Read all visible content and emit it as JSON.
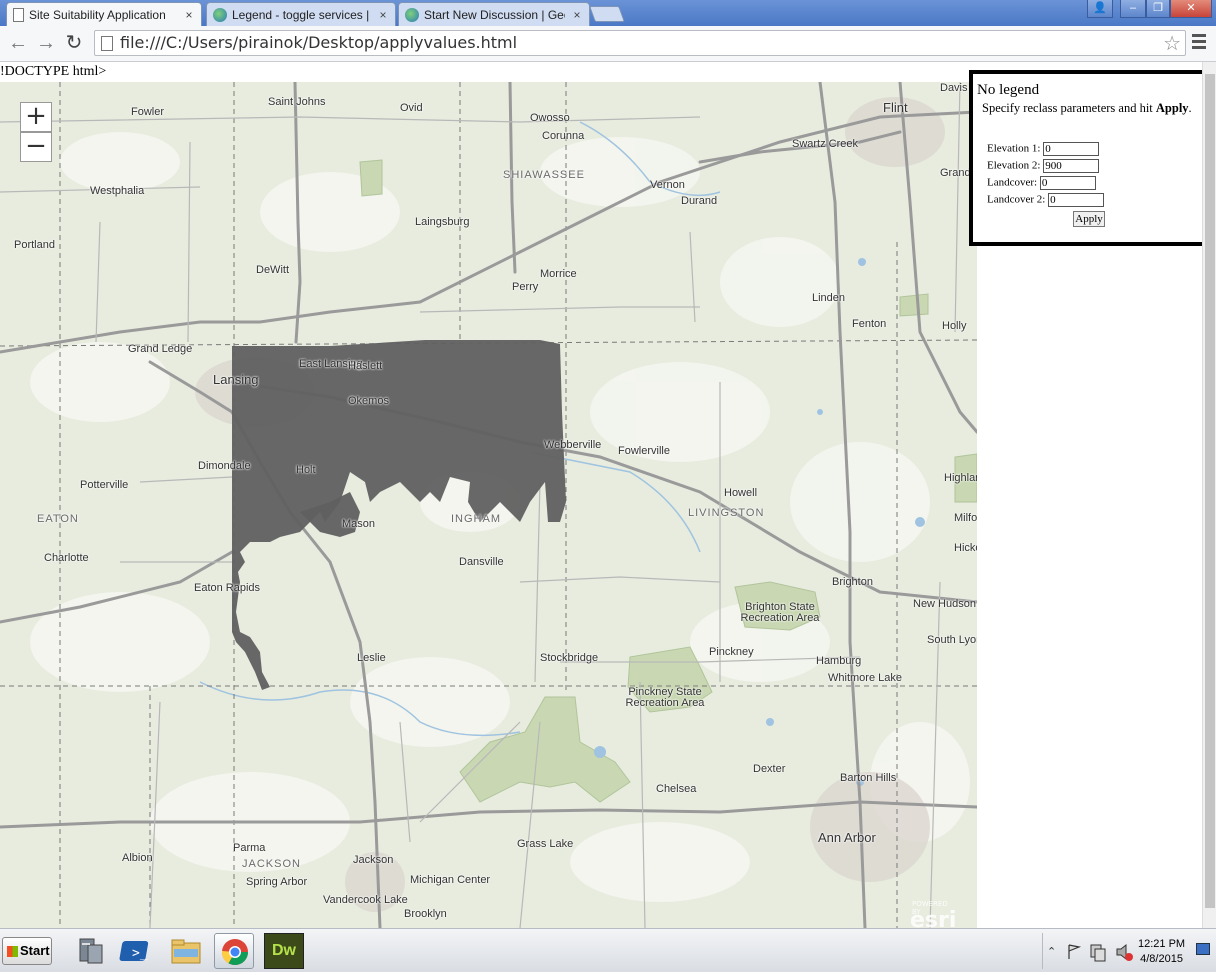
{
  "browser": {
    "tabs": [
      {
        "title": "Site Suitability Application",
        "close": "×",
        "active": true
      },
      {
        "title": "Legend - toggle services | Ar",
        "close": "×",
        "active": false
      },
      {
        "title": "Start New Discussion | GeoN",
        "close": "×",
        "active": false
      }
    ],
    "window_controls": {
      "minimize": "–",
      "restore": "❐",
      "close": "✕"
    },
    "nav": {
      "back": "←",
      "forward": "→",
      "reload": "↻"
    },
    "address": "file:///C:/Users/pirainok/Desktop/applyvalues.html",
    "bookmark_star": "☆"
  },
  "page": {
    "doctype_text": "!DOCTYPE html>",
    "map": {
      "zoom_in": "+",
      "zoom_out": "−",
      "attribution_small": "POWERED BY",
      "attribution": "esri",
      "place_labels": [
        "Flint",
        "Davis",
        "Saint Johns",
        "Ovid",
        "Owosso",
        "Corunna",
        "Fowler",
        "Westphalia",
        "SHIAWASSEE",
        "Vernon",
        "Durand",
        "Swartz Creek",
        "Grand Blanc",
        "Laingsburg",
        "Portland",
        "DeWitt",
        "Morrice",
        "Perry",
        "Linden",
        "Fenton",
        "Holly",
        "Grand Ledge",
        "Lansing",
        "East Lansing",
        "Haslett",
        "Okemos",
        "Webberville",
        "Fowlerville",
        "Dimondale",
        "Holt",
        "Potterville",
        "EATON",
        "Mason",
        "INGHAM",
        "Howell",
        "LIVINGSTON",
        "Charlotte",
        "Dansville",
        "Eaton Rapids",
        "Brighton",
        "New Hudson",
        "Brighton State Recreation Area",
        "South Lyon",
        "Leslie",
        "Stockbridge",
        "Pinckney",
        "Hamburg",
        "Whitmore Lake",
        "Pinckney State Recreation Area",
        "Chelsea",
        "Dexter",
        "Barton Hills",
        "Ann Arbor",
        "Parma",
        "JACKSON",
        "Jackson",
        "Albion",
        "Grass Lake",
        "Spring Arbor",
        "Vandercook Lake",
        "Michigan Center",
        "Highland Recreat",
        "Milford",
        "Hickory Corners",
        "Brooklyn"
      ]
    },
    "legend_panel": {
      "title": "No legend",
      "instruction_prefix": "Specify reclass parameters and hit ",
      "instruction_bold": "Apply",
      "instruction_suffix": ".",
      "fields": [
        {
          "label": "Elevation 1:",
          "value": "0"
        },
        {
          "label": "Elevation 2:",
          "value": "900"
        },
        {
          "label": "Landcover:",
          "value": "0"
        },
        {
          "label": "Landcover 2:",
          "value": "0"
        }
      ],
      "apply_label": "Apply"
    }
  },
  "taskbar": {
    "start_label": "Start",
    "apps": [
      "server-manager",
      "powershell",
      "file-explorer",
      "chrome",
      "dreamweaver"
    ],
    "dreamweaver_label": "Dw",
    "clock_time": "12:21 PM",
    "clock_date": "4/8/2015"
  },
  "colors": {
    "map_base": "#e7ecdf",
    "raster_overlay": "#606060",
    "park_green": "#c9d8b3",
    "road": "#9a9a9a",
    "water": "#9fc3e0",
    "chrome_frame": "#4a78c6"
  }
}
